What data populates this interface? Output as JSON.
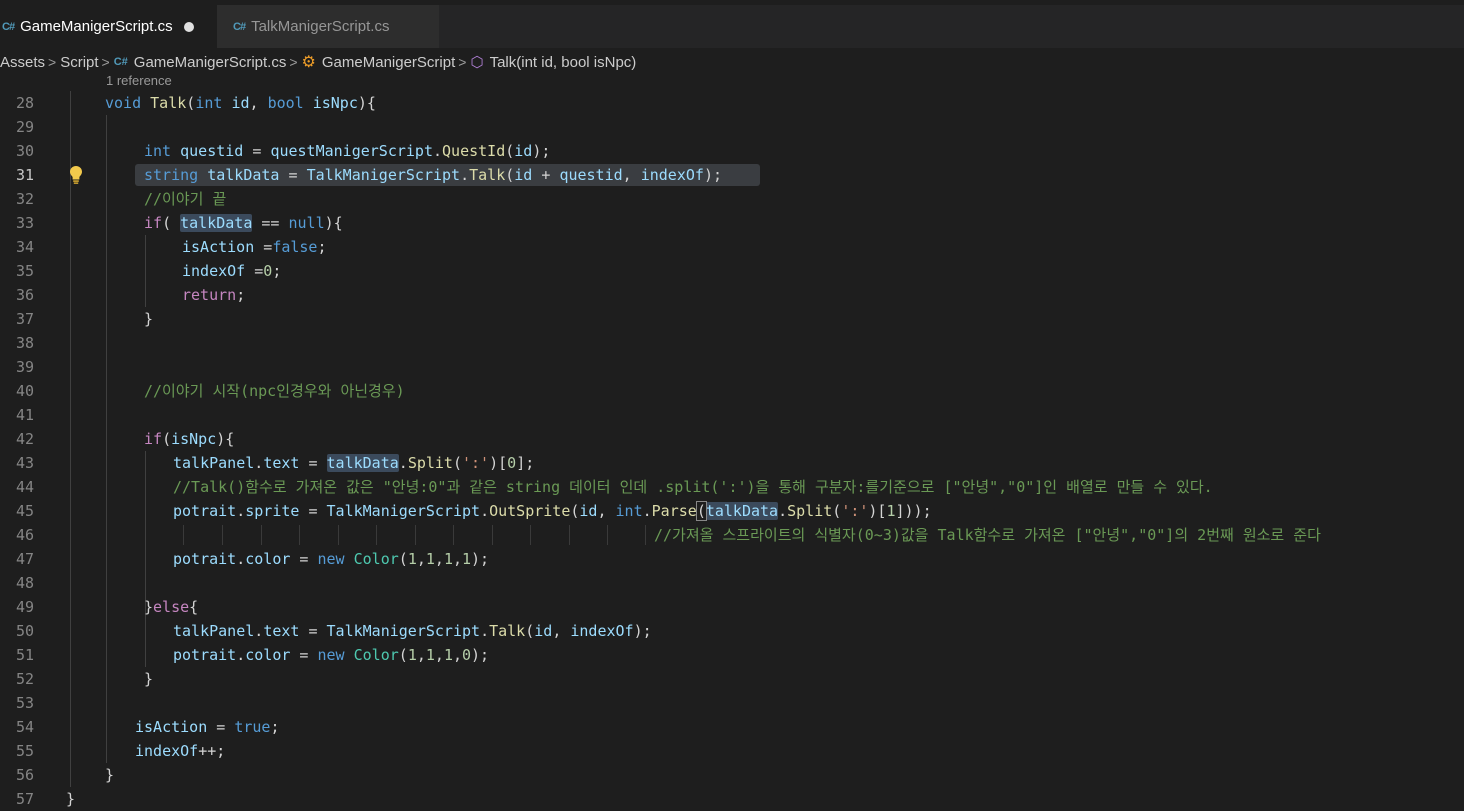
{
  "tabs": [
    {
      "label": "GameManigerScript.cs",
      "icon": "csharp-file-icon",
      "active": true,
      "dirty": true
    },
    {
      "label": "TalkManigerScript.cs",
      "icon": "csharp-file-icon",
      "active": false,
      "dirty": false
    }
  ],
  "breadcrumb": {
    "items": [
      "Assets",
      "Script",
      "GameManigerScript.cs",
      "GameManigerScript",
      "Talk(int id, bool isNpc)"
    ]
  },
  "codelens": "1 reference",
  "line_numbers": [
    "28",
    "29",
    "30",
    "31",
    "32",
    "33",
    "34",
    "35",
    "36",
    "37",
    "38",
    "39",
    "40",
    "41",
    "42",
    "43",
    "44",
    "45",
    "46",
    "47",
    "48",
    "49",
    "50",
    "51",
    "52",
    "53",
    "54",
    "55",
    "56",
    "57"
  ],
  "current_line": "31",
  "code": {
    "l28": {
      "t1": "void",
      "t2": " ",
      "t3": "Talk",
      "t4": "(",
      "t5": "int",
      "t6": " ",
      "t7": "id",
      "t8": ", ",
      "t9": "bool",
      "t10": " ",
      "t11": "isNpc",
      "t12": "){"
    },
    "l30": {
      "t1": "int",
      "t2": " ",
      "t3": "questid",
      "t4": " = ",
      "t5": "questManigerScript",
      "t6": ".",
      "t7": "QuestId",
      "t8": "(",
      "t9": "id",
      "t10": ");"
    },
    "l31": {
      "t1": "string",
      "t2": " ",
      "t3": "talkData",
      "t4": " = ",
      "t5": "TalkManigerScript",
      "t6": ".",
      "t7": "Talk",
      "t8": "(",
      "t9": "id",
      "t10": " + ",
      "t11": "questid",
      "t12": ", ",
      "t13": "indexOf",
      "t14": ");"
    },
    "l32": "//이야기 끝",
    "l33": {
      "t1": "if",
      "t2": "( ",
      "t3": "talkData",
      "t4": " == ",
      "t5": "null",
      "t6": "){"
    },
    "l34": {
      "t1": "isAction",
      "t2": " =",
      "t3": "false",
      "t4": ";"
    },
    "l35": {
      "t1": "indexOf",
      "t2": " =",
      "t3": "0",
      "t4": ";"
    },
    "l36": {
      "t1": "return",
      "t2": ";"
    },
    "l37": "}",
    "l40": "//이야기 시작(npc인경우와 아닌경우)",
    "l42": {
      "t1": "if",
      "t2": "(",
      "t3": "isNpc",
      "t4": "){"
    },
    "l43": {
      "t1": "talkPanel",
      "t2": ".",
      "t3": "text",
      "t4": " = ",
      "t5": "talkData",
      "t6": ".",
      "t7": "Split",
      "t8": "(",
      "t9": "':'",
      "t10": ")[",
      "t11": "0",
      "t12": "];"
    },
    "l44": "//Talk()함수로 가져온 값은 \"안녕:0\"과 같은 string 데이터 인데 .split(':')을 통해 구분자:를기준으로 [\"안녕\",\"0\"]인 배열로 만들 수 있다.",
    "l45": {
      "t1": "potrait",
      "t2": ".",
      "t3": "sprite",
      "t4": " = ",
      "t5": "TalkManigerScript",
      "t6": ".",
      "t7": "OutSprite",
      "t8": "(",
      "t9": "id",
      "t10": ", ",
      "t11": "int",
      "t12": ".",
      "t13": "Parse",
      "t14": "(",
      "t15": "talkData",
      "t16": ".",
      "t17": "Split",
      "t18": "(",
      "t19": "':'",
      "t20": ")[",
      "t21": "1",
      "t22": "]));"
    },
    "l46": "//가져올 스프라이트의 식별자(0~3)값을 Talk함수로 가져온 [\"안녕\",\"0\"]의 2번째 원소로 준다",
    "l47": {
      "t1": "potrait",
      "t2": ".",
      "t3": "color",
      "t4": " = ",
      "t5": "new",
      "t6": " ",
      "t7": "Color",
      "t8": "(",
      "t9": "1",
      "t10": ",",
      "t11": "1",
      "t12": ",",
      "t13": "1",
      "t14": ",",
      "t15": "1",
      "t16": ");"
    },
    "l49": {
      "t1": "}",
      "t2": "else",
      "t3": "{"
    },
    "l50": {
      "t1": "talkPanel",
      "t2": ".",
      "t3": "text",
      "t4": " = ",
      "t5": "TalkManigerScript",
      "t6": ".",
      "t7": "Talk",
      "t8": "(",
      "t9": "id",
      "t10": ", ",
      "t11": "indexOf",
      "t12": ");"
    },
    "l51": {
      "t1": "potrait",
      "t2": ".",
      "t3": "color",
      "t4": " = ",
      "t5": "new",
      "t6": " ",
      "t7": "Color",
      "t8": "(",
      "t9": "1",
      "t10": ",",
      "t11": "1",
      "t12": ",",
      "t13": "1",
      "t14": ",",
      "t15": "0",
      "t16": ");"
    },
    "l52": "}",
    "l54": {
      "t1": "isAction",
      "t2": " = ",
      "t3": "true",
      "t4": ";"
    },
    "l55": {
      "t1": "indexOf",
      "t2": "++;"
    },
    "l56": "}",
    "l57": "}"
  },
  "colors": {
    "background": "#1e1e1e",
    "keyword": "#569cd6",
    "control": "#c586c0",
    "variable": "#9cdcfe",
    "function": "#dcdcaa",
    "type": "#4ec9b0",
    "string": "#ce9178",
    "number": "#b5cea8",
    "comment": "#6a9955"
  }
}
